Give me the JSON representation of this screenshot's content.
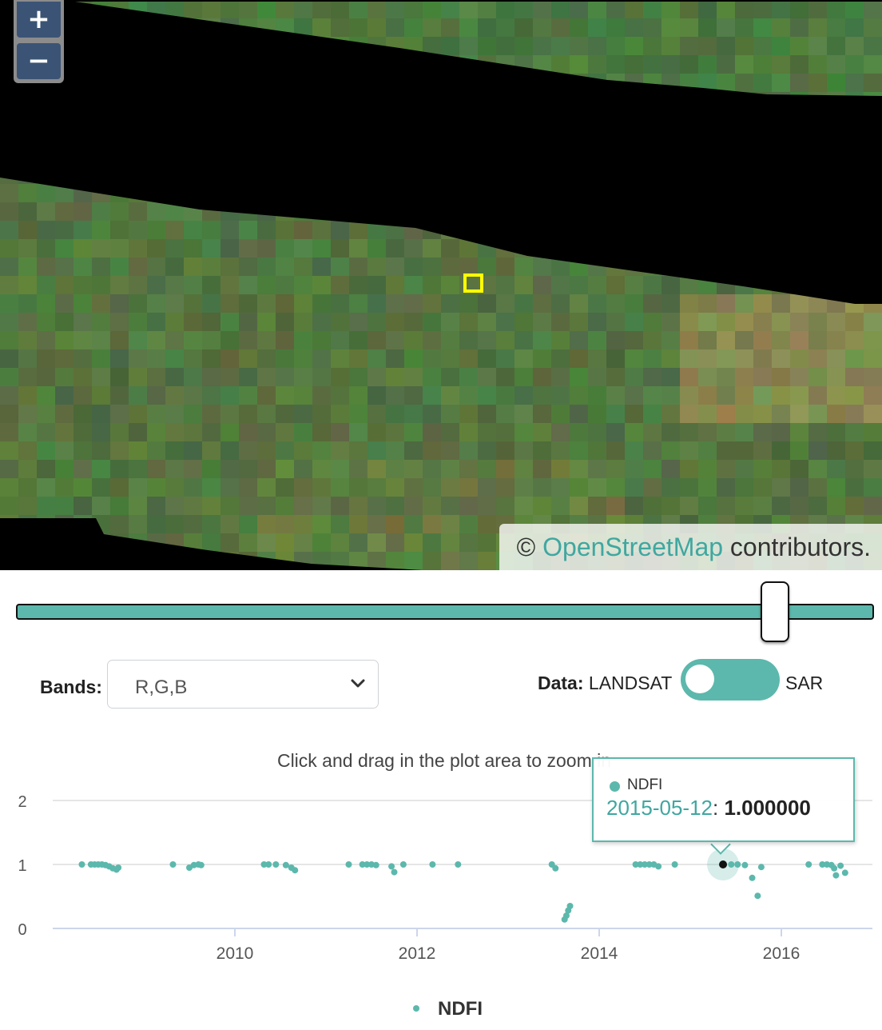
{
  "map": {
    "zoom_in_label": "+",
    "zoom_out_label": "−",
    "attribution": {
      "prefix": "© ",
      "link": "OpenStreetMap",
      "suffix": " contributors."
    },
    "marker_color": "#ffff00"
  },
  "slider": {
    "value_fraction": 0.88,
    "track_color": "#5cb8ac"
  },
  "controls": {
    "bands_label": "Bands:",
    "bands_value": "R,G,B",
    "data_label": "Data:",
    "data_option_left": "LANDSAT",
    "data_option_right": "SAR",
    "toggle_state": "LANDSAT"
  },
  "chart": {
    "zoom_hint": "Click and drag in the plot area to zoom in",
    "tooltip": {
      "series": "NDFI",
      "date": "2015-05-12",
      "value": "1.000000"
    }
  },
  "chart_data": {
    "type": "scatter",
    "title": "",
    "xlabel": "",
    "ylabel": "",
    "xlim": [
      2008.0,
      2017.0
    ],
    "ylim": [
      0,
      2
    ],
    "y_ticks": [
      0,
      1,
      2
    ],
    "x_ticks": [
      "2010",
      "2012",
      "2014",
      "2016"
    ],
    "grid": true,
    "legend": "bottom-center",
    "color": "#5cb8ac",
    "series": [
      {
        "name": "NDFI",
        "points": [
          [
            2008.32,
            1.0
          ],
          [
            2008.42,
            1.0
          ],
          [
            2008.46,
            1.0
          ],
          [
            2008.5,
            1.0
          ],
          [
            2008.54,
            1.0
          ],
          [
            2008.58,
            0.99
          ],
          [
            2008.62,
            0.97
          ],
          [
            2008.66,
            0.94
          ],
          [
            2008.7,
            0.92
          ],
          [
            2008.72,
            0.95
          ],
          [
            2009.32,
            1.0
          ],
          [
            2009.5,
            0.95
          ],
          [
            2009.55,
            0.99
          ],
          [
            2009.6,
            1.0
          ],
          [
            2009.63,
            0.99
          ],
          [
            2010.32,
            1.0
          ],
          [
            2010.37,
            1.0
          ],
          [
            2010.45,
            1.0
          ],
          [
            2010.56,
            0.99
          ],
          [
            2010.62,
            0.95
          ],
          [
            2010.66,
            0.91
          ],
          [
            2011.25,
            1.0
          ],
          [
            2011.4,
            1.0
          ],
          [
            2011.45,
            1.0
          ],
          [
            2011.5,
            1.0
          ],
          [
            2011.55,
            0.99
          ],
          [
            2011.72,
            0.97
          ],
          [
            2011.75,
            0.88
          ],
          [
            2011.85,
            1.0
          ],
          [
            2012.17,
            1.0
          ],
          [
            2012.45,
            1.0
          ],
          [
            2013.48,
            1.0
          ],
          [
            2013.52,
            0.94
          ],
          [
            2013.62,
            0.14
          ],
          [
            2013.64,
            0.2
          ],
          [
            2013.66,
            0.28
          ],
          [
            2013.68,
            0.35
          ],
          [
            2014.4,
            1.0
          ],
          [
            2014.45,
            1.0
          ],
          [
            2014.5,
            1.0
          ],
          [
            2014.55,
            1.0
          ],
          [
            2014.6,
            1.0
          ],
          [
            2014.65,
            0.97
          ],
          [
            2014.83,
            1.0
          ],
          [
            2015.36,
            1.0
          ],
          [
            2015.45,
            1.0
          ],
          [
            2015.52,
            1.0
          ],
          [
            2015.6,
            0.99
          ],
          [
            2015.68,
            0.79
          ],
          [
            2015.74,
            0.51
          ],
          [
            2015.78,
            0.96
          ],
          [
            2016.3,
            1.0
          ],
          [
            2016.45,
            1.0
          ],
          [
            2016.5,
            1.0
          ],
          [
            2016.55,
            0.99
          ],
          [
            2016.58,
            0.94
          ],
          [
            2016.6,
            0.83
          ],
          [
            2016.65,
            0.98
          ],
          [
            2016.7,
            0.87
          ]
        ],
        "highlighted": [
          2015.36,
          1.0
        ]
      }
    ]
  }
}
